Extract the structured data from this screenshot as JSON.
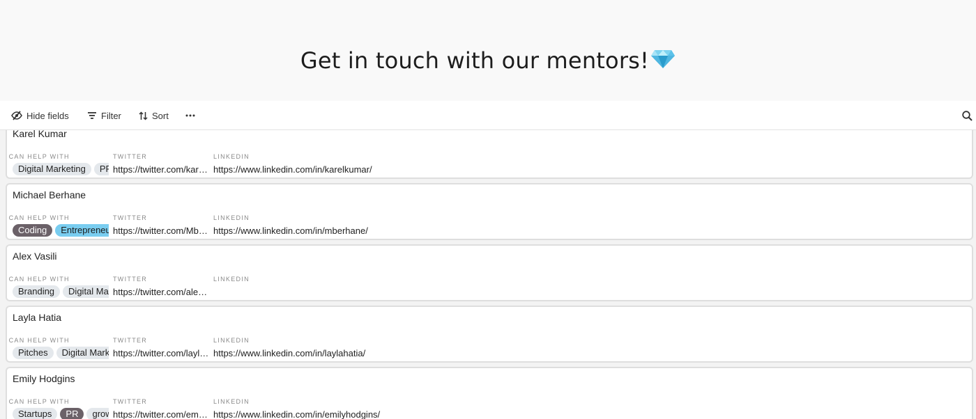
{
  "header": {
    "title": "Get in touch with our mentors!",
    "title_emoji": "gem-icon",
    "gem_colors": [
      "#7fd4f0",
      "#4fb6e0",
      "#2a9ccc"
    ]
  },
  "toolbar": {
    "hide_fields_label": "Hide fields",
    "filter_label": "Filter",
    "sort_label": "Sort",
    "more_icon": "ellipsis-icon",
    "search_icon": "search-icon"
  },
  "field_labels": {
    "help": "I CAN HELP WITH",
    "twitter": "TWITTER",
    "linkedin": "LINKEDIN"
  },
  "tag_colors": {
    "light": {
      "bg": "#e4e8ec",
      "fg": "#222222"
    },
    "dark": {
      "bg": "#6b6168",
      "fg": "#ffffff"
    },
    "blue": {
      "bg": "#79cdf0",
      "fg": "#1a1a1a"
    }
  },
  "mentors": [
    {
      "name": "Karel Kumar",
      "tags": [
        {
          "text": "Digital Marketing",
          "color": "light"
        },
        {
          "text": "PR",
          "color": "light"
        }
      ],
      "twitter": "https://twitter.com/karelkumar",
      "linkedin": "https://www.linkedin.com/in/karelkumar/"
    },
    {
      "name": "Michael Berhane",
      "tags": [
        {
          "text": "Coding",
          "color": "dark"
        },
        {
          "text": "Entrepreneurship",
          "color": "blue"
        }
      ],
      "twitter": "https://twitter.com/Mberhane",
      "linkedin": "https://www.linkedin.com/in/mberhane/"
    },
    {
      "name": "Alex Vasili",
      "tags": [
        {
          "text": "Branding",
          "color": "light"
        },
        {
          "text": "Digital Marketing",
          "color": "light"
        }
      ],
      "twitter": "https://twitter.com/alexvasili",
      "linkedin": ""
    },
    {
      "name": "Layla Hatia",
      "tags": [
        {
          "text": "Pitches",
          "color": "light"
        },
        {
          "text": "Digital Marketing",
          "color": "light"
        }
      ],
      "twitter": "https://twitter.com/laylahatia",
      "linkedin": "https://www.linkedin.com/in/laylahatia/"
    },
    {
      "name": "Emily Hodgins",
      "tags": [
        {
          "text": "Startups",
          "color": "light"
        },
        {
          "text": "PR",
          "color": "dark"
        },
        {
          "text": "growth",
          "color": "light"
        }
      ],
      "twitter": "https://twitter.com/emilyhodgins",
      "linkedin": "https://www.linkedin.com/in/emilyhodgins/"
    }
  ]
}
